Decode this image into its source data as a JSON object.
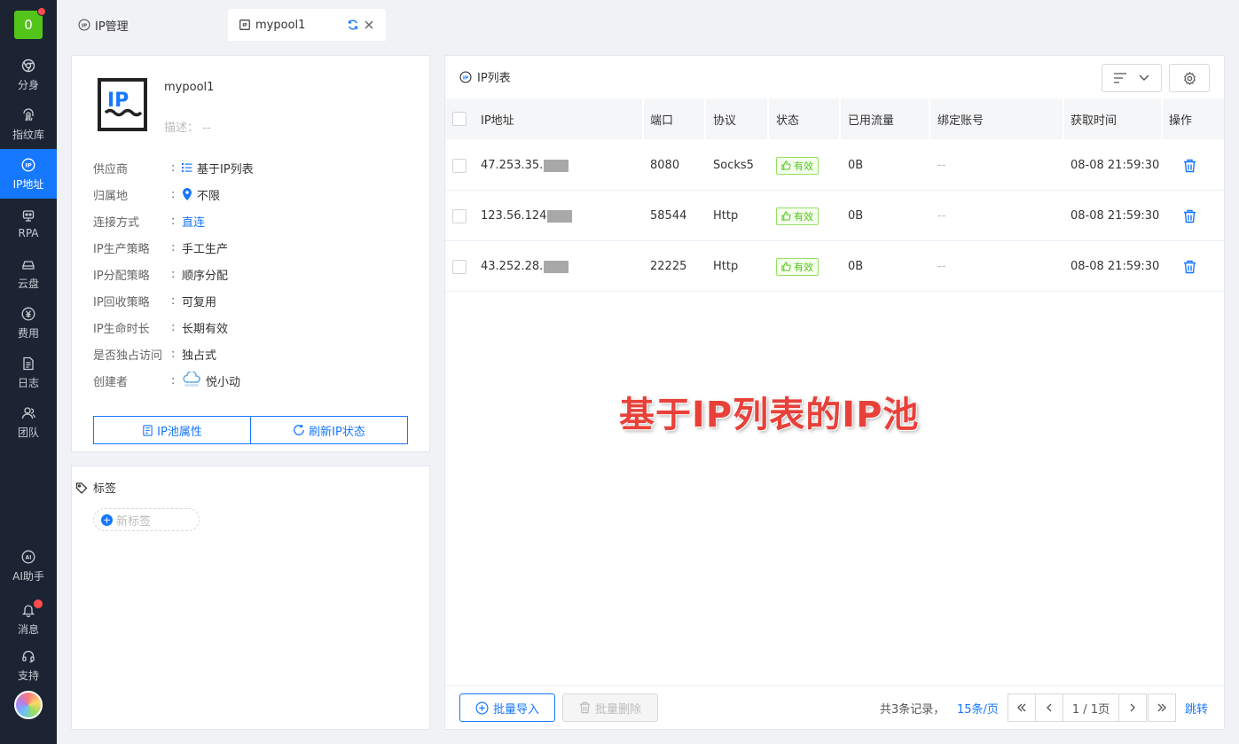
{
  "sidebar": {
    "logo_text": "0",
    "items": [
      {
        "label": "分身",
        "icon": "chrome-icon"
      },
      {
        "label": "指纹库",
        "icon": "fingerprint-icon"
      },
      {
        "label": "IP地址",
        "icon": "ip-icon"
      },
      {
        "label": "RPA",
        "icon": "robot-icon"
      },
      {
        "label": "云盘",
        "icon": "cloud-drive-icon"
      },
      {
        "label": "费用",
        "icon": "yen-icon"
      },
      {
        "label": "日志",
        "icon": "log-icon"
      },
      {
        "label": "团队",
        "icon": "team-icon"
      }
    ],
    "bottom_items": [
      {
        "label": "AI助手",
        "icon": "ai-icon"
      },
      {
        "label": "消息",
        "icon": "bell-icon"
      },
      {
        "label": "支持",
        "icon": "headset-icon"
      }
    ],
    "active_index": 2
  },
  "tabs": [
    {
      "label": "IP管理"
    },
    {
      "label": "mypool1"
    }
  ],
  "pool": {
    "name": "mypool1",
    "description": "描述： --",
    "info": [
      {
        "label": "供应商",
        "value": "基于IP列表",
        "icon": "list-icon"
      },
      {
        "label": "归属地",
        "value": "不限",
        "icon": "location-icon"
      },
      {
        "label": "连接方式",
        "value": "直连"
      },
      {
        "label": "IP生产策略",
        "value": "手工生产"
      },
      {
        "label": "IP分配策略",
        "value": "顺序分配"
      },
      {
        "label": "IP回收策略",
        "value": "可复用"
      },
      {
        "label": "IP生命时长",
        "value": "长期有效"
      },
      {
        "label": "是否独占访问",
        "value": "独占式"
      },
      {
        "label": "创建者",
        "value": "悦小动",
        "icon": "creator-avatar-icon"
      }
    ],
    "attr_button": "IP池属性",
    "refresh_button": "刷新IP状态"
  },
  "tags": {
    "title": "标签",
    "new_tag": "新标签"
  },
  "ip_list": {
    "title": "IP列表",
    "columns": [
      "IP地址",
      "端口",
      "协议",
      "状态",
      "已用流量",
      "绑定账号",
      "获取时间",
      "操作"
    ],
    "rows": [
      {
        "ip": "47.253.35.",
        "port": "8080",
        "protocol": "Socks5",
        "status": "有效",
        "traffic": "0B",
        "account": "--",
        "time": "08-08 21:59:30"
      },
      {
        "ip": "123.56.124",
        "port": "58544",
        "protocol": "Http",
        "status": "有效",
        "traffic": "0B",
        "account": "--",
        "time": "08-08 21:59:30"
      },
      {
        "ip": "43.252.28.",
        "port": "22225",
        "protocol": "Http",
        "status": "有效",
        "traffic": "0B",
        "account": "--",
        "time": "08-08 21:59:30"
      }
    ],
    "watermark": "基于IP列表的IP池",
    "import_button": "批量导入",
    "delete_button": "批量删除",
    "total_text": "共3条记录，",
    "page_size": "15条/页",
    "page_indicator": "1 / 1页",
    "jump": "跳转"
  },
  "colors": {
    "primary": "#1677ff",
    "sidebar_bg": "#1c2433",
    "success": "#52c41a",
    "danger": "#ff4d4f",
    "watermark": "#e8413a"
  }
}
